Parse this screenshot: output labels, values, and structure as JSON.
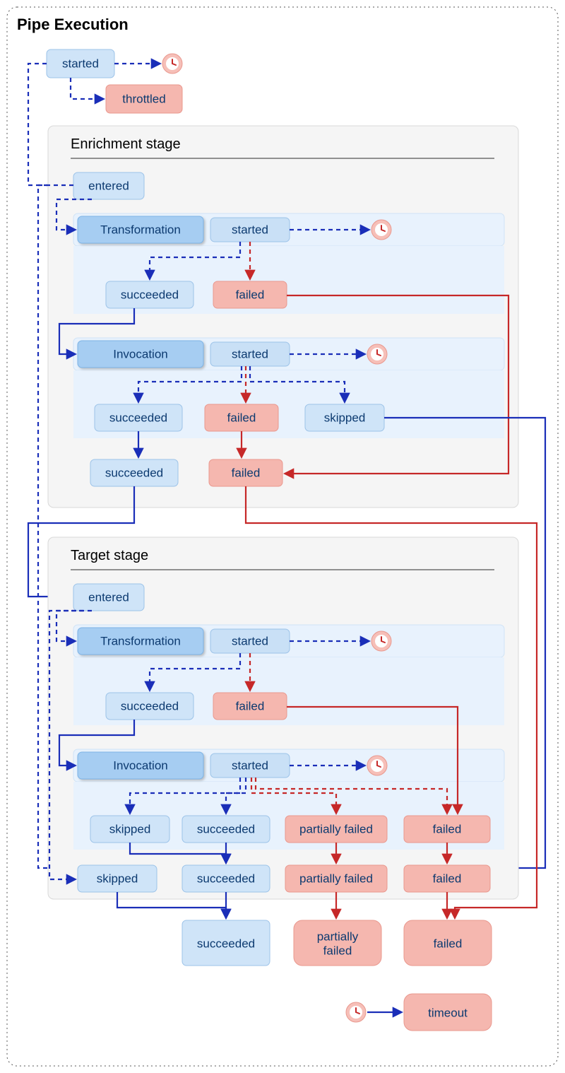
{
  "diagram": {
    "title": "Pipe Execution",
    "top": {
      "started": "started",
      "throttled": "throttled"
    },
    "enrichment": {
      "title": "Enrichment stage",
      "entered": "entered",
      "transformation": {
        "header": "Transformation",
        "started": "started",
        "succeeded": "succeeded",
        "failed": "failed"
      },
      "invocation": {
        "header": "Invocation",
        "started": "started",
        "succeeded": "succeeded",
        "failed": "failed",
        "skipped": "skipped"
      },
      "out": {
        "succeeded": "succeeded",
        "failed": "failed"
      }
    },
    "target": {
      "title": "Target stage",
      "entered": "entered",
      "transformation": {
        "header": "Transformation",
        "started": "started",
        "succeeded": "succeeded",
        "failed": "failed"
      },
      "invocation": {
        "header": "Invocation",
        "started": "started",
        "skipped": "skipped",
        "succeeded": "succeeded",
        "partially": "partially failed",
        "failed": "failed"
      },
      "out": {
        "skipped": "skipped",
        "succeeded": "succeeded",
        "partially": "partially failed",
        "failed": "failed"
      }
    },
    "final": {
      "succeeded": "succeeded",
      "partially": "partially\nfailed",
      "failed": "failed",
      "timeout": "timeout"
    }
  },
  "colors": {
    "blue": "#1a2eb8",
    "red": "#c62828",
    "nodeBlue": "#cfe4f8",
    "nodeRed": "#f5b7af"
  }
}
